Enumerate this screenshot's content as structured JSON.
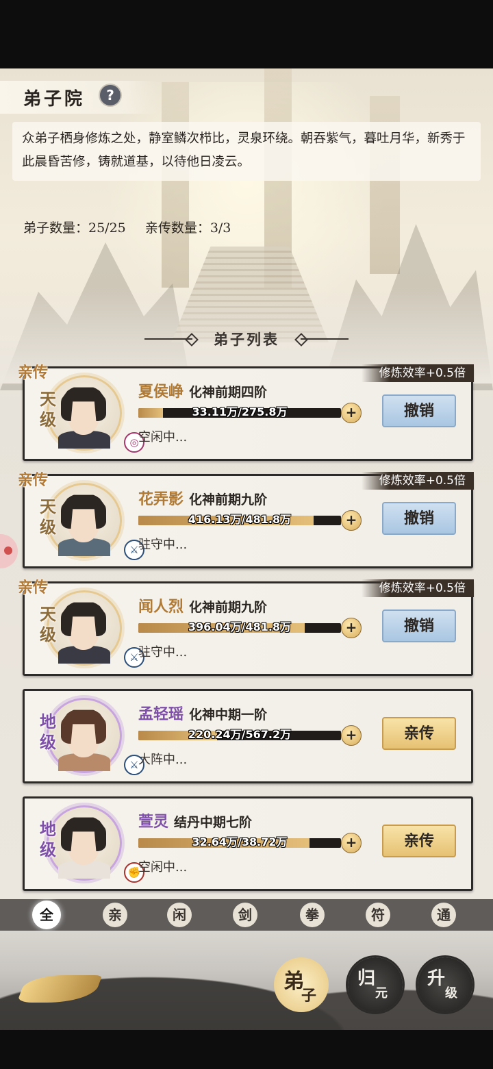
{
  "header": {
    "title": "弟子院",
    "help": "?",
    "description": "众弟子栖身修炼之处，静室鳞次栉比，灵泉环绕。朝吞紫气，暮吐月华，新秀于此晨昏苦修，铸就道基，以待他日凌云。",
    "disciple_count": "弟子数量：25/25",
    "inner_count": "亲传数量：3/3"
  },
  "list_title": "弟子列表",
  "disciples": [
    {
      "tag": "亲传",
      "efficiency": "修炼效率+0.5倍",
      "grade": "天级",
      "name": "夏侯峥",
      "realm": "化神前期四阶",
      "progress_text": "33.11万/275.8万",
      "progress": 0.12,
      "status": "空闲中...",
      "action": "撤销",
      "element": "spiral"
    },
    {
      "tag": "亲传",
      "efficiency": "修炼效率+0.5倍",
      "grade": "天级",
      "name": "花弄影",
      "realm": "化神前期九阶",
      "progress_text": "416.13万/481.8万",
      "progress": 0.864,
      "status": "驻守中...",
      "action": "撤销",
      "element": "sword"
    },
    {
      "tag": "亲传",
      "efficiency": "修炼效率+0.5倍",
      "grade": "天级",
      "name": "闻人烈",
      "realm": "化神前期九阶",
      "progress_text": "396.04万/481.8万",
      "progress": 0.822,
      "status": "驻守中...",
      "action": "撤销",
      "element": "sword"
    },
    {
      "tag": "",
      "efficiency": "",
      "grade": "地级",
      "name": "孟轻瑶",
      "realm": "化神中期一阶",
      "progress_text": "220.24万/567.2万",
      "progress": 0.388,
      "status": "大阵中...",
      "action": "亲传",
      "element": "sword"
    },
    {
      "tag": "",
      "efficiency": "",
      "grade": "地级",
      "name": "萱灵",
      "realm": "结丹中期七阶",
      "progress_text": "32.64万/38.72万",
      "progress": 0.843,
      "status": "空闲中...",
      "action": "亲传",
      "element": "fist"
    }
  ],
  "filters": [
    "全",
    "亲",
    "闲",
    "剑",
    "拳",
    "符",
    "通"
  ],
  "bottom_tabs": [
    {
      "a": "弟",
      "b": "子"
    },
    {
      "a": "归",
      "b": "元"
    },
    {
      "a": "升",
      "b": "级"
    }
  ],
  "colors": {
    "gold": "#b07a34",
    "purple": "#7d4fa8",
    "revoke_blue": "#a9c6e2",
    "promote_gold": "#e6c173"
  }
}
